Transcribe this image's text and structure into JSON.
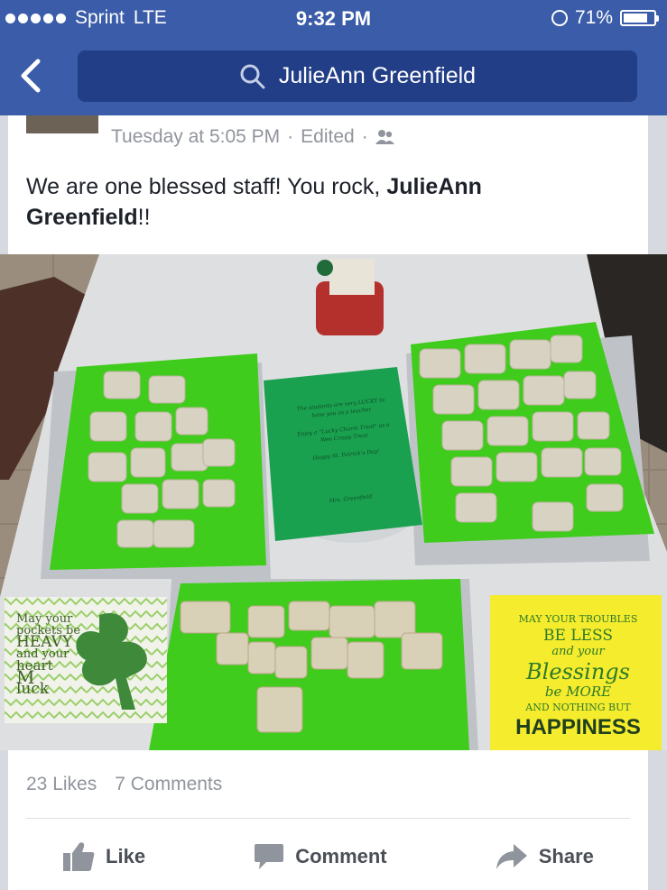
{
  "status": {
    "carrier": "Sprint",
    "network": "LTE",
    "time": "9:32 PM",
    "battery": "71%"
  },
  "search": {
    "query": "JulieAnn Greenfield"
  },
  "post": {
    "timestamp": "Tuesday at 5:05 PM",
    "edited": "Edited",
    "sep": "·",
    "text_before": "We are one blessed staff! You rock, ",
    "mention": "JulieAnn Greenfield",
    "text_after": "!!",
    "photo": {
      "card_left": [
        "May your",
        "pockets be",
        "HEAVY",
        "and your",
        "heart",
        "M",
        "luck"
      ],
      "card_right": [
        "MAY YOUR TROUBLES",
        "BE LESS",
        "and your",
        "Blessings",
        "be MORE",
        "AND NOTHING BUT",
        "HAPPINESS"
      ],
      "note": [
        "The students are very LUCKY to",
        "have you as a teacher",
        "Enjoy a \"Lucky Charm Treat\" as a",
        "Wee Crispy Treat",
        "Happy St. Patrick's Day!",
        "Mrs. Greenfield"
      ]
    }
  },
  "stats": {
    "likes": "23 Likes",
    "comments": "7 Comments"
  },
  "actions": {
    "like": "Like",
    "comment": "Comment",
    "share": "Share"
  }
}
